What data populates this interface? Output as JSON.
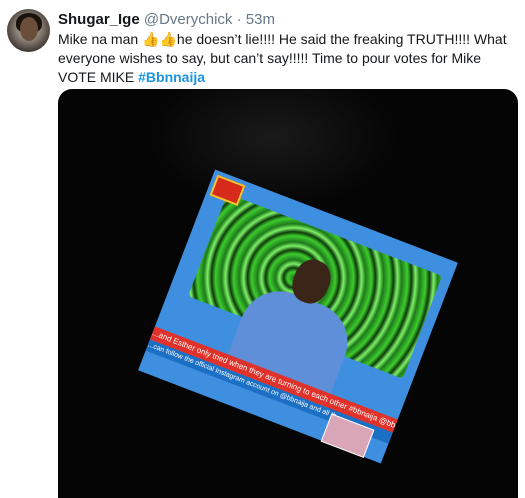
{
  "tweet": {
    "display_name": "Shugar_Ige",
    "handle": "@Dverychick",
    "separator": "·",
    "time": "53m",
    "text_before_emoji": "Mike na man ",
    "emoji": "👍👍",
    "text_after_emoji": "he doesn’t lie!!!! He said the freaking TRUTH!!!! What everyone wishes to say, but can’t say!!!!!  Time to pour votes for Mike VOTE MIKE ",
    "hashtag": "#Bbnnaija"
  },
  "media": {
    "ticker_text": "...and Esther only tried when they are turning to each other #bbnaija @bbn...",
    "ticker_sub_text": "...can follow the official Instagram account on @bbnaija and all th..."
  }
}
